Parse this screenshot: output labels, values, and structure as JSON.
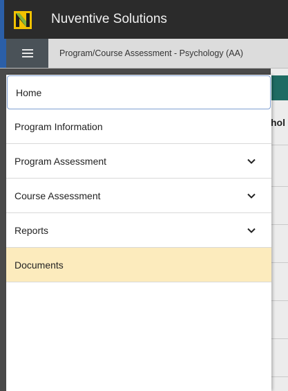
{
  "app": {
    "title": "Nuventive Solutions"
  },
  "subbar": {
    "title": "Program/Course Assessment - Psychology (AA)"
  },
  "background": {
    "partial_text": "hol"
  },
  "nav": {
    "items": [
      {
        "label": "Home"
      },
      {
        "label": "Program Information"
      },
      {
        "label": "Program Assessment"
      },
      {
        "label": "Course Assessment"
      },
      {
        "label": "Reports"
      },
      {
        "label": "Documents"
      }
    ]
  },
  "icons": {
    "logo": "nuventive-logo",
    "menu": "hamburger-menu-icon",
    "expand": "chevron-down-icon"
  },
  "colors": {
    "topbar": "#2b2b2b",
    "menu_button": "#4a5258",
    "active_item": "#fcebbd",
    "focus_border": "#7e9ed1",
    "brand_green": "#8dc63f",
    "brand_yellow": "#f2c200"
  }
}
